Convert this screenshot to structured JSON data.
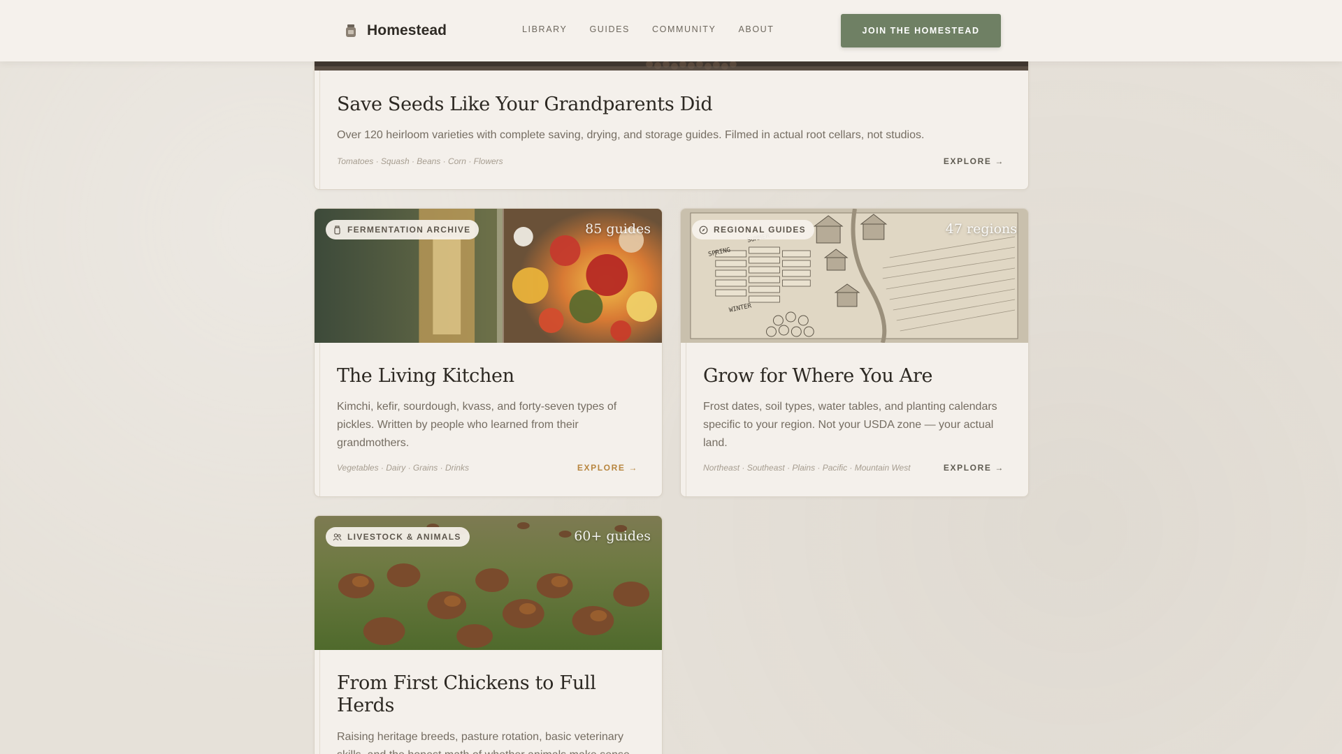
{
  "header": {
    "logo_text": "Homestead",
    "nav": [
      "LIBRARY",
      "GUIDES",
      "COMMUNITY",
      "ABOUT"
    ],
    "cta_label": "JOIN THE HOMESTEAD"
  },
  "cards": [
    {
      "title": "Save Seeds Like Your Grandparents Did",
      "description": "Over 120 heirloom varieties with complete saving, drying, and storage guides. Filmed in actual root cellars, not studios.",
      "tags": "Tomatoes · Squash · Beans · Corn · Flowers",
      "explore": "EXPLORE →"
    },
    {
      "badge": "FERMENTATION ARCHIVE",
      "badge_icon": "jar-icon",
      "count": "85 guides",
      "title": "The Living Kitchen",
      "description": "Kimchi, kefir, sourdough, kvass, and forty-seven types of pickles. Written by people who learned from their grandmothers.",
      "tags": "Vegetables · Dairy · Grains · Drinks",
      "explore": "EXPLORE →"
    },
    {
      "badge": "REGIONAL GUIDES",
      "badge_icon": "compass-icon",
      "count": "47 regions",
      "title": "Grow for Where You Are",
      "description": "Frost dates, soil types, water tables, and planting calendars specific to your region. Not your USDA zone — your actual land.",
      "tags": "Northeast · Southeast · Plains · Pacific · Mountain West",
      "explore": "EXPLORE →",
      "map_labels": [
        "SPRING",
        "SUMMER",
        "WINTER"
      ]
    },
    {
      "badge": "LIVESTOCK & ANIMALS",
      "badge_icon": "users-icon",
      "count": "60+ guides",
      "title": "From First Chickens to Full Herds",
      "description": "Raising heritage breeds, pasture rotation, basic veterinary skills, and the honest math of whether animals make sense for your land.",
      "tags": "",
      "explore": ""
    }
  ],
  "colors": {
    "page_bg": "#e6e1d9",
    "card_bg": "#f4f0eb",
    "cta_bg": "#6f8064",
    "accent_explore": "#b7853e"
  }
}
